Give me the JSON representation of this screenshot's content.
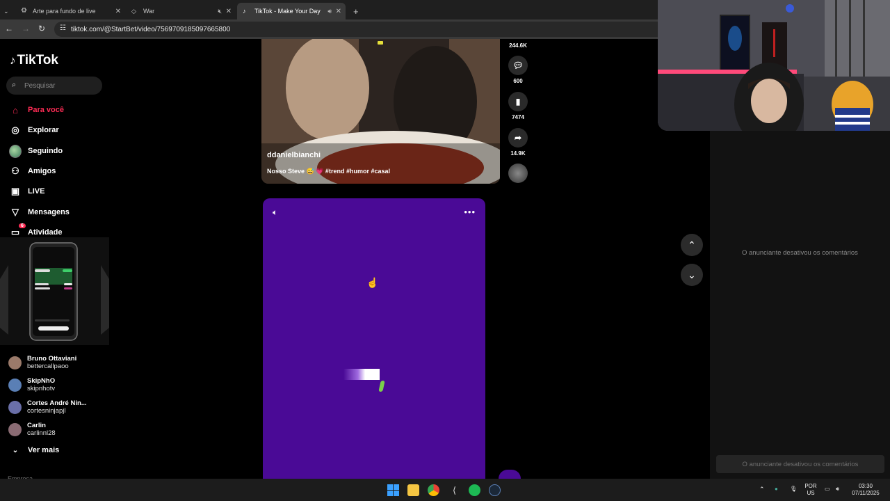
{
  "browser": {
    "tabs": [
      {
        "title": "Arte para fundo de live",
        "close": "✕"
      },
      {
        "title": "War",
        "close": "✕"
      },
      {
        "title": "TikTok - Make Your Day",
        "close": "✕"
      }
    ],
    "new_tab": "+",
    "url": "tiktok.com/@StartBet/video/7569709185097665800"
  },
  "sidebar": {
    "logo": "TikTok",
    "search_placeholder": "Pesquisar",
    "nav": [
      {
        "label": "Para você",
        "icon": "home-icon",
        "active": true
      },
      {
        "label": "Explorar",
        "icon": "compass-icon"
      },
      {
        "label": "Seguindo",
        "icon": "following-icon"
      },
      {
        "label": "Amigos",
        "icon": "friends-icon"
      },
      {
        "label": "LIVE",
        "icon": "live-icon"
      },
      {
        "label": "Mensagens",
        "icon": "messages-icon"
      },
      {
        "label": "Atividade",
        "icon": "activity-icon",
        "badge": "6"
      }
    ],
    "following": [
      {
        "name": "Bruno Ottaviani",
        "handle": "bettercallpaoo",
        "color": "#9b7a6a"
      },
      {
        "name": "SkipNhO",
        "handle": "skipnhotv",
        "color": "#5a7fb5"
      },
      {
        "name": "Cortes André Nin...",
        "handle": "cortesninjapjl",
        "color": "#6a6fa8"
      },
      {
        "name": "Carlin",
        "handle": "carlinnl28",
        "color": "#8a6b73"
      }
    ],
    "more": "Ver mais",
    "footer": "Empresa"
  },
  "video1": {
    "author": "ddanielbianchi",
    "caption": "Nosso Steve 😅 💗 #trend #humor #casal"
  },
  "actions": {
    "likes": "244.6K",
    "comments": "600",
    "saves": "7474",
    "shares": "14.9K"
  },
  "comments_panel": {
    "disabled_text": "O anunciante desativou os comentários",
    "input_text": "O anunciante desativou os comentários"
  },
  "taskbar": {
    "lang_top": "POR",
    "lang_bottom": "US",
    "time": "03:30",
    "date": "07/11/2025"
  },
  "colors": {
    "accent": "#fe2c55",
    "video2_bg": "#4a0a96"
  }
}
